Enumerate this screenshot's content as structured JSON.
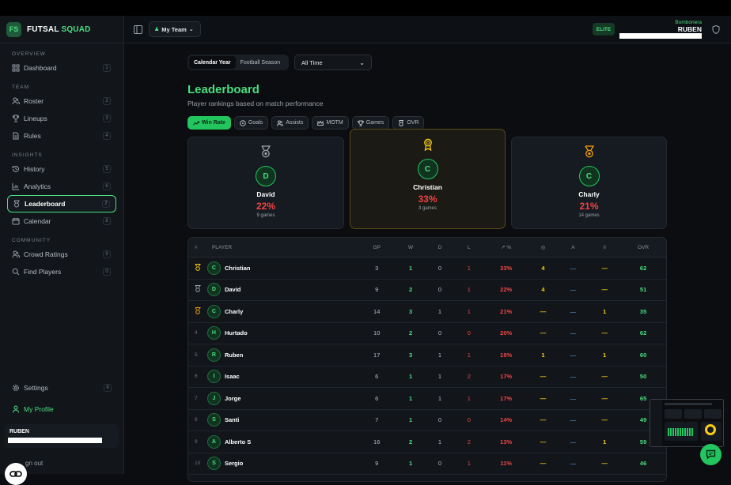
{
  "app": {
    "logo": "FS",
    "name_part1": "FUTSAL",
    "name_part2": "SQUAD"
  },
  "sidebar": {
    "sections": {
      "overview": "OVERVIEW",
      "team": "TEAM",
      "insights": "INSIGHTS",
      "community": "COMMUNITY"
    },
    "items": [
      {
        "label": "Dashboard",
        "num": "1",
        "icon": "grid-icon"
      },
      {
        "label": "Roster",
        "num": "2",
        "icon": "users-icon"
      },
      {
        "label": "Lineups",
        "num": "3",
        "icon": "trophy-icon"
      },
      {
        "label": "Rules",
        "num": "4",
        "icon": "document-icon"
      },
      {
        "label": "History",
        "num": "5",
        "icon": "history-icon"
      },
      {
        "label": "Analytics",
        "num": "6",
        "icon": "chart-icon"
      },
      {
        "label": "Leaderboard",
        "num": "7",
        "icon": "medal-icon"
      },
      {
        "label": "Calendar",
        "num": "8",
        "icon": "calendar-icon"
      },
      {
        "label": "Crowd Ratings",
        "num": "9",
        "icon": "users-icon"
      },
      {
        "label": "Find Players",
        "num": "0",
        "icon": "search-icon"
      }
    ],
    "settings": {
      "label": "Settings",
      "num": "8"
    },
    "profile": {
      "label": "My Profile"
    },
    "user": {
      "name": "RUBEN"
    },
    "signout": "gn out"
  },
  "header": {
    "team_select": "My Team",
    "badge": "ELITE",
    "club": "Bombonera",
    "user": "RUBEN"
  },
  "main": {
    "period_tabs": [
      "Calendar Year",
      "Football Season"
    ],
    "time_filter": "All Time",
    "title": "Leaderboard",
    "subtitle": "Player rankings based on match performance",
    "filters": [
      "Win Rate",
      "Goals",
      "Assists",
      "MOTM",
      "Games",
      "OVR"
    ],
    "podium": [
      {
        "initial": "D",
        "name": "David",
        "pct": "22%",
        "games": "9 games"
      },
      {
        "initial": "C",
        "name": "Christian",
        "pct": "33%",
        "games": "3 games"
      },
      {
        "initial": "C",
        "name": "Charly",
        "pct": "21%",
        "games": "14 games"
      }
    ],
    "table": {
      "headers": {
        "rank": "#",
        "player": "PLAYER",
        "gp": "GP",
        "w": "W",
        "d": "D",
        "l": "L",
        "pct": "%",
        "a": "A",
        "ovr": "OVR"
      },
      "rows": [
        {
          "rank": "",
          "medal": "gold",
          "initial": "C",
          "name": "Christian",
          "gp": "3",
          "w": "1",
          "d": "0",
          "l": "1",
          "pct": "33%",
          "g": "4",
          "a": "—",
          "m": "—",
          "ovr": "62"
        },
        {
          "rank": "",
          "medal": "silver",
          "initial": "D",
          "name": "David",
          "gp": "9",
          "w": "2",
          "d": "0",
          "l": "1",
          "pct": "22%",
          "g": "4",
          "a": "—",
          "m": "—",
          "ovr": "51"
        },
        {
          "rank": "",
          "medal": "bronze",
          "initial": "C",
          "name": "Charly",
          "gp": "14",
          "w": "3",
          "d": "1",
          "l": "1",
          "pct": "21%",
          "g": "—",
          "a": "—",
          "m": "1",
          "ovr": "35"
        },
        {
          "rank": "4",
          "initial": "H",
          "name": "Hurtado",
          "gp": "10",
          "w": "2",
          "d": "0",
          "l": "0",
          "pct": "20%",
          "g": "—",
          "a": "—",
          "m": "—",
          "ovr": "62"
        },
        {
          "rank": "5",
          "initial": "R",
          "name": "Ruben",
          "gp": "17",
          "w": "3",
          "d": "1",
          "l": "1",
          "pct": "18%",
          "g": "1",
          "a": "—",
          "m": "1",
          "ovr": "60"
        },
        {
          "rank": "6",
          "initial": "I",
          "name": "Isaac",
          "gp": "6",
          "w": "1",
          "d": "1",
          "l": "2",
          "pct": "17%",
          "g": "—",
          "a": "—",
          "m": "—",
          "ovr": "50"
        },
        {
          "rank": "7",
          "initial": "J",
          "name": "Jorge",
          "gp": "6",
          "w": "1",
          "d": "1",
          "l": "1",
          "pct": "17%",
          "g": "—",
          "a": "—",
          "m": "—",
          "ovr": "65"
        },
        {
          "rank": "8",
          "initial": "S",
          "name": "Santi",
          "gp": "7",
          "w": "1",
          "d": "0",
          "l": "0",
          "pct": "14%",
          "g": "—",
          "a": "—",
          "m": "—",
          "ovr": "49"
        },
        {
          "rank": "9",
          "initial": "A",
          "name": "Alberto S",
          "gp": "16",
          "w": "2",
          "d": "1",
          "l": "2",
          "pct": "13%",
          "g": "—",
          "a": "—",
          "m": "1",
          "ovr": "59"
        },
        {
          "rank": "10",
          "initial": "S",
          "name": "Sergio",
          "gp": "9",
          "w": "1",
          "d": "0",
          "l": "1",
          "pct": "11%",
          "g": "—",
          "a": "—",
          "m": "—",
          "ovr": "46"
        }
      ]
    }
  },
  "colors": {
    "accent": "#4ade80",
    "loss": "#ef4444",
    "gold": "#facc15",
    "bronze": "#f59e0b",
    "silver": "#9aa2ab"
  }
}
